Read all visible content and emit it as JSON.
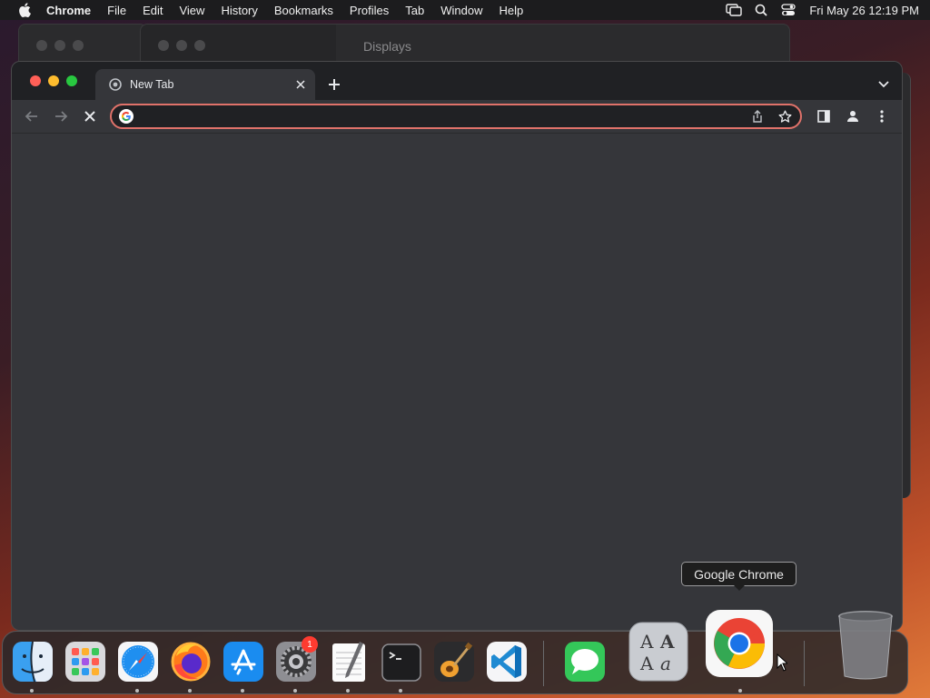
{
  "menubar": {
    "app_name": "Chrome",
    "items": [
      "File",
      "Edit",
      "View",
      "History",
      "Bookmarks",
      "Profiles",
      "Tab",
      "Window",
      "Help"
    ],
    "clock": "Fri May 26  12:19 PM"
  },
  "background_window": {
    "title": "Displays"
  },
  "browser": {
    "tab": {
      "title": "New Tab"
    },
    "omnibox": {
      "value": "",
      "placeholder": ""
    }
  },
  "dock": {
    "items": [
      "Finder",
      "Launchpad",
      "Safari",
      "Firefox",
      "App Store",
      "System Settings",
      "TextEdit",
      "Terminal",
      "GarageBand",
      "Visual Studio Code",
      "Messages",
      "Font Book",
      "Google Chrome",
      "Trash"
    ],
    "system_settings_badge": "1",
    "tooltip": "Google Chrome"
  },
  "colors": {
    "accent_focus": "#e0726a",
    "tab_bg": "#35363a",
    "strip_bg": "#202124"
  }
}
